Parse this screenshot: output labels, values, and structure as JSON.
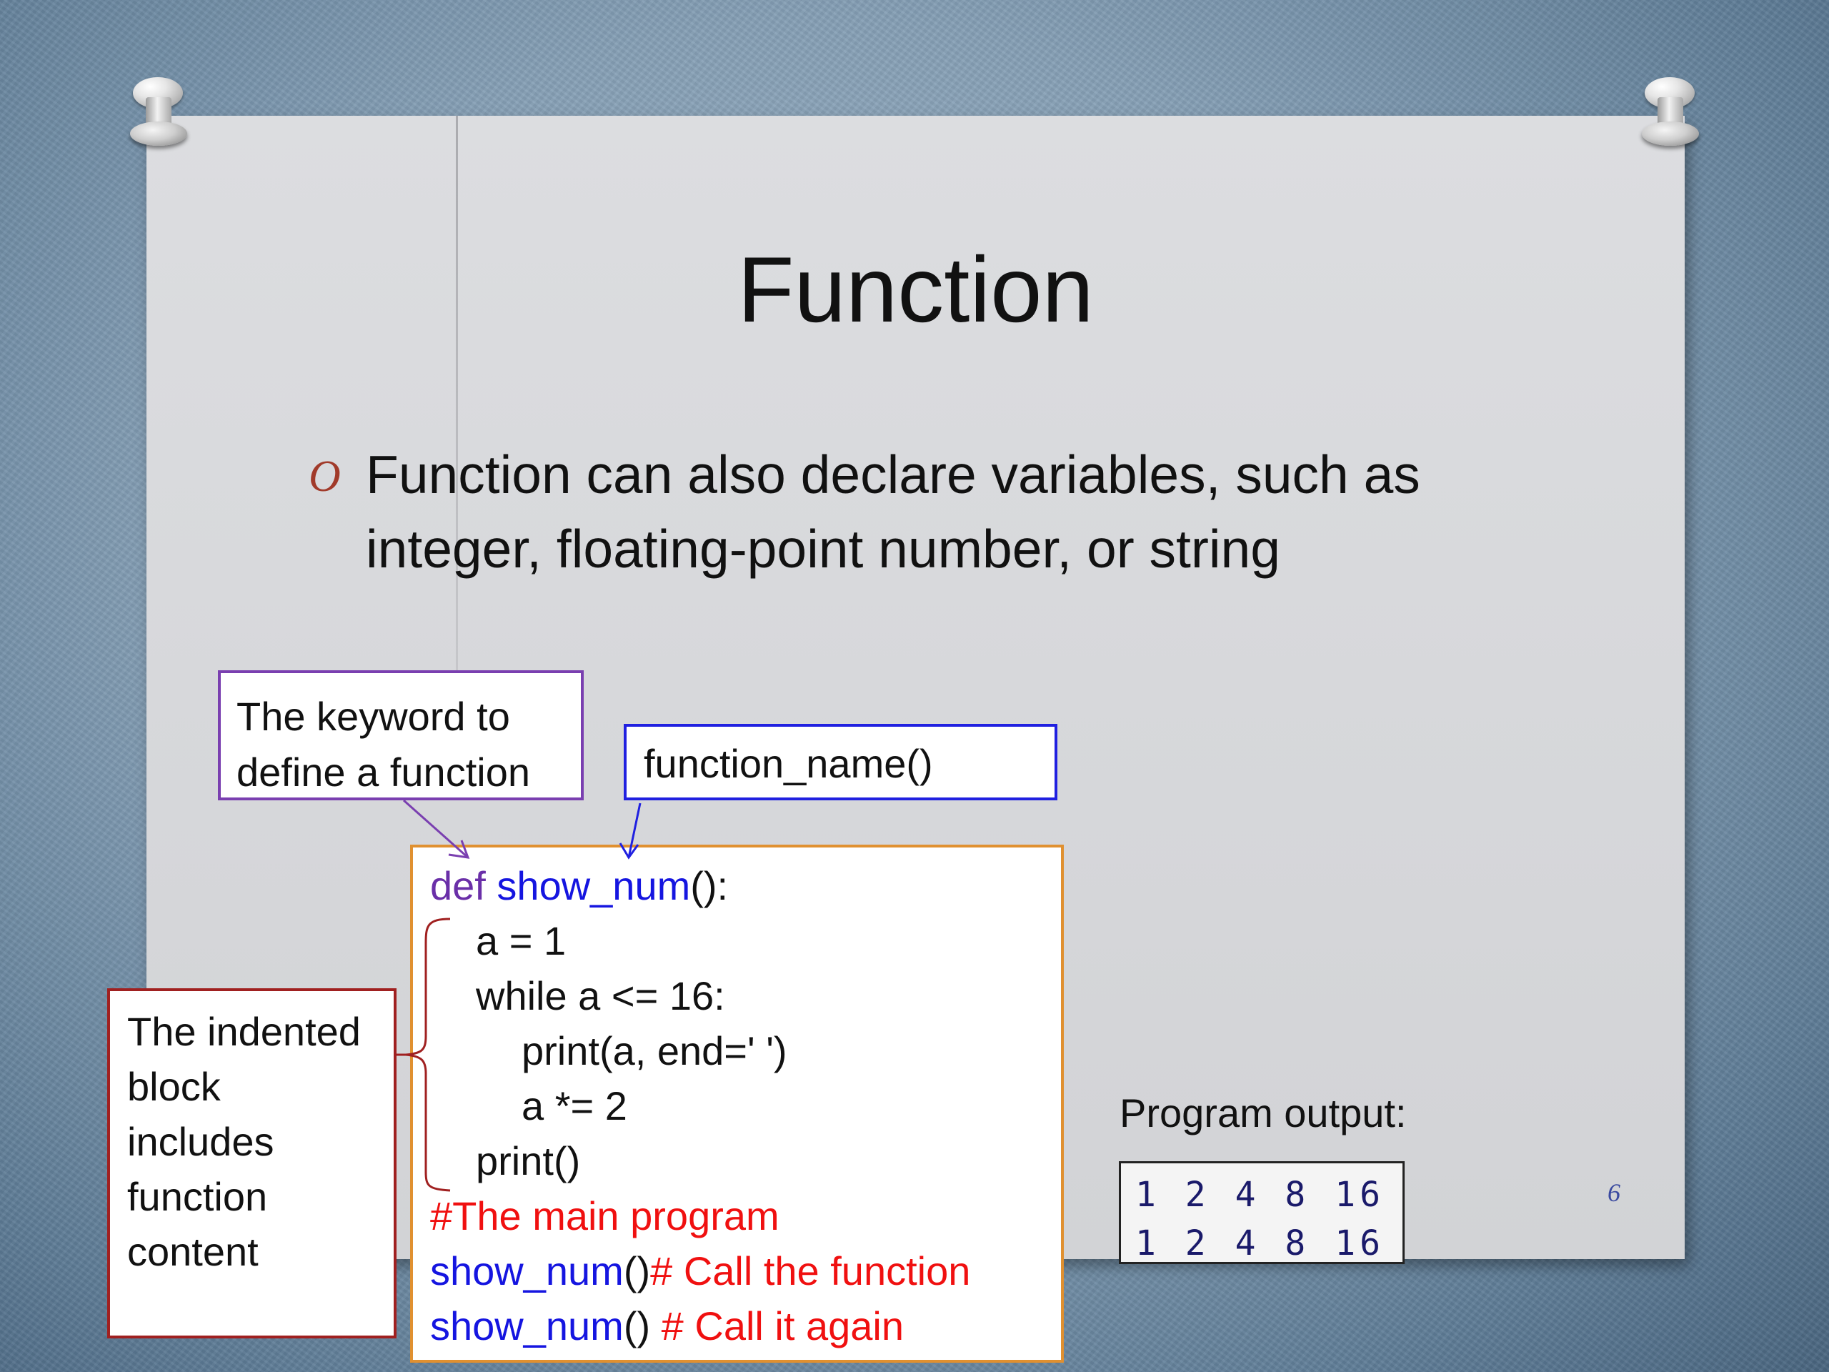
{
  "slide": {
    "title": "Function",
    "bullet_marker": "O",
    "bullet_text": "Function can also declare variables, such as integer, floating-point number, or string",
    "page_number": "6"
  },
  "callouts": {
    "keyword": "The keyword to define a function",
    "function_name": "function_name()",
    "indented_block": "The indented block includes function content"
  },
  "code": {
    "line1_kw": "def",
    "line1_fn": "show_num",
    "line1_rest": "():",
    "line2": "a = 1",
    "line3": "while a <= 16:",
    "line4": "print(a, end=' ')",
    "line5": "a *= 2",
    "line6": "print()",
    "line7": "#The main program",
    "line8_fn": "show_num",
    "line8_paren": "()",
    "line8_comment": "# Call the function",
    "line9_fn": "show_num",
    "line9_paren": "() ",
    "line9_comment": "# Call it again"
  },
  "output": {
    "label": "Program output:",
    "lines": [
      "1 2 4 8 16",
      "1 2 4 8 16"
    ]
  },
  "colors": {
    "keyword": "#6a2fa8",
    "function_name": "#1515e0",
    "comment": "#f01010",
    "code_border": "#e09030",
    "indent_border": "#a02020"
  }
}
